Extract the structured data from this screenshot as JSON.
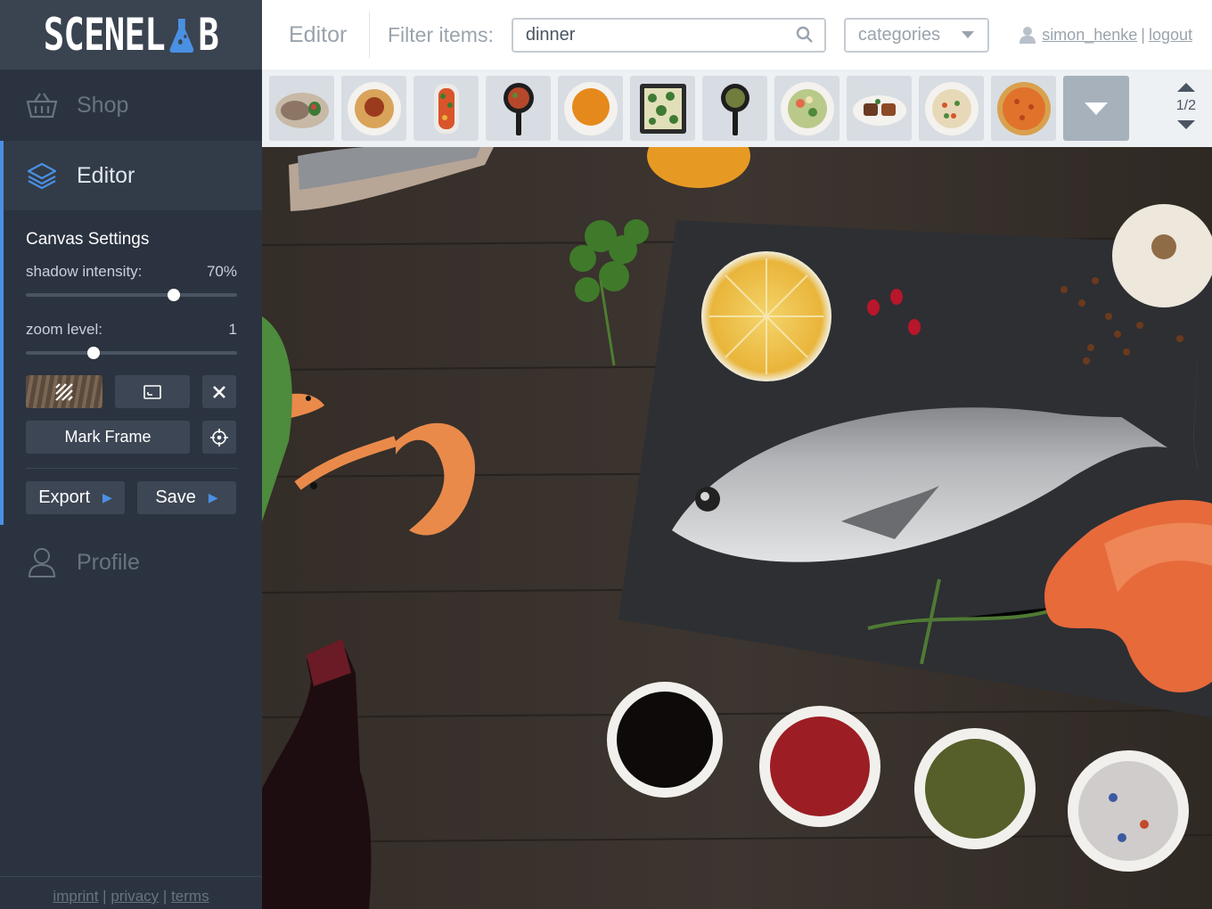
{
  "app": {
    "logo_text_left": "SCENEL",
    "logo_text_right": "B"
  },
  "sidebar": {
    "nav": [
      {
        "label": "Shop",
        "icon": "basket-icon"
      },
      {
        "label": "Editor",
        "icon": "layers-icon"
      },
      {
        "label": "Profile",
        "icon": "user-icon"
      }
    ],
    "canvas_settings": {
      "title": "Canvas Settings",
      "shadow_label": "shadow intensity:",
      "shadow_value": "70%",
      "shadow_fraction": 0.7,
      "zoom_label": "zoom level:",
      "zoom_value": "1",
      "mark_frame": "Mark Frame",
      "export": "Export",
      "save": "Save"
    },
    "footer": {
      "imprint": "imprint",
      "sep": "|",
      "privacy": "privacy",
      "terms": "terms"
    }
  },
  "header": {
    "title": "Editor",
    "filter_label": "Filter items:",
    "search_value": "dinner",
    "category_placeholder": "categories",
    "username": "simon_henke",
    "separator": "|",
    "logout": "logout"
  },
  "strip": {
    "pager": "1/2",
    "items": [
      "fish-dish",
      "spaghetti",
      "tomato-platter",
      "pan-dish",
      "orange-soup",
      "broccoli-tray",
      "pan-greens",
      "salad-bowl",
      "grill-plate",
      "rice-bowl",
      "pizza"
    ]
  },
  "colors": {
    "accent": "#4a90e2",
    "sidebar_bg": "#2b3340",
    "header_bg": "#ffffff",
    "canvas_wood": "#3b332d"
  }
}
